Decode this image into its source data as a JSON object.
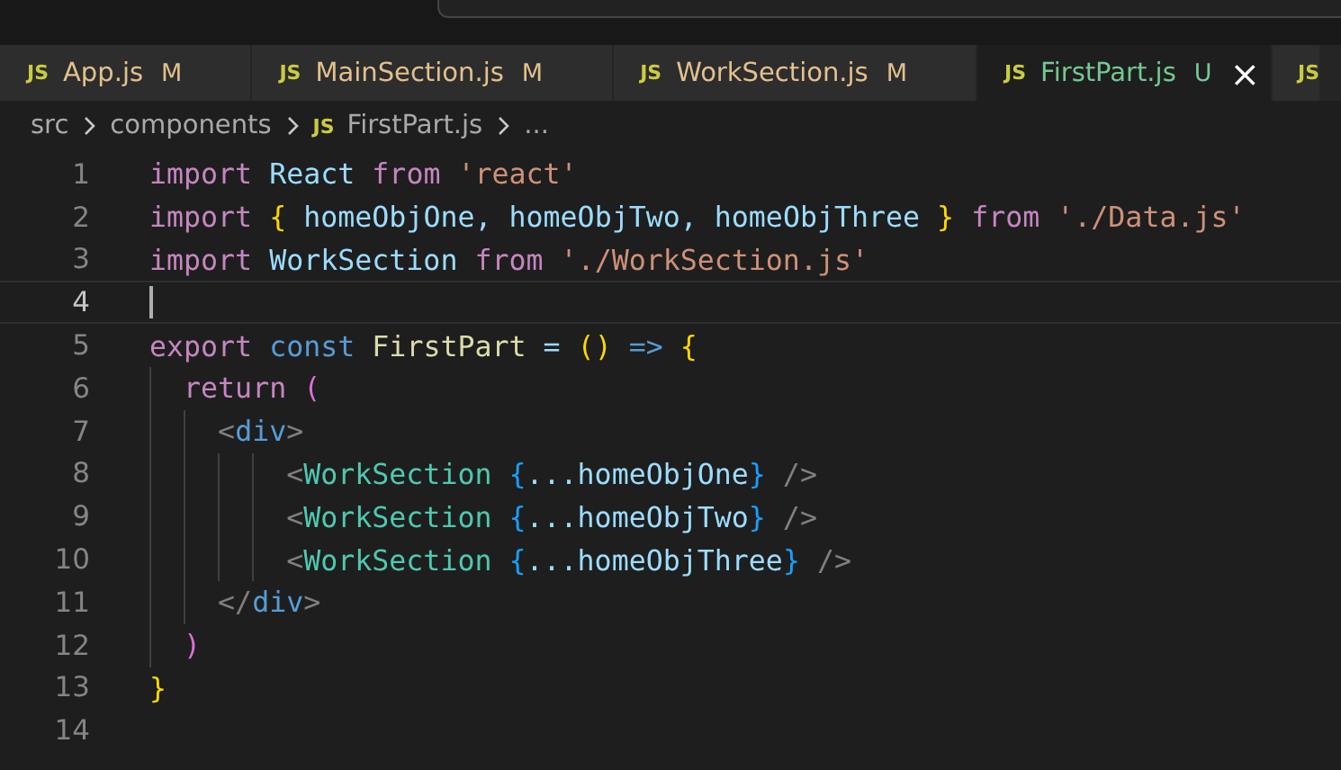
{
  "tabs": [
    {
      "icon": "JS",
      "label": "App.js",
      "status": "M",
      "kind": "modified",
      "selected": false
    },
    {
      "icon": "JS",
      "label": "MainSection.js",
      "status": "M",
      "kind": "modified",
      "selected": false
    },
    {
      "icon": "JS",
      "label": "WorkSection.js",
      "status": "M",
      "kind": "modified",
      "selected": false
    },
    {
      "icon": "JS",
      "label": "FirstPart.js",
      "status": "U",
      "kind": "untracked",
      "selected": true,
      "close": "×"
    },
    {
      "icon": "JS",
      "selected": false
    }
  ],
  "breadcrumb": [
    {
      "label": "src"
    },
    {
      "label": "components"
    },
    {
      "icon": "JS",
      "label": "FirstPart.js"
    },
    {
      "label": "..."
    }
  ],
  "editor": {
    "lines": [
      {
        "number": "1",
        "tokens": [
          {
            "kind": "kw",
            "text": "import"
          },
          {
            "kind": "var",
            "text": " React"
          },
          {
            "kind": "kw",
            "text": " from"
          },
          {
            "kind": "str",
            "text": " 'react'"
          }
        ]
      },
      {
        "number": "2",
        "tokens": [
          {
            "kind": "kw",
            "text": "import"
          },
          {
            "kind": "b1",
            "text": " {"
          },
          {
            "kind": "var",
            "text": " homeObjOne"
          },
          {
            "kind": "plain",
            "text": ","
          },
          {
            "kind": "var",
            "text": " homeObjTwo"
          },
          {
            "kind": "plain",
            "text": ","
          },
          {
            "kind": "var",
            "text": " homeObjThree"
          },
          {
            "kind": "b1",
            "text": " }"
          },
          {
            "kind": "kw",
            "text": " from"
          },
          {
            "kind": "str",
            "text": " './Data.js'"
          }
        ]
      },
      {
        "number": "3",
        "tokens": [
          {
            "kind": "kw",
            "text": "import"
          },
          {
            "kind": "var",
            "text": " WorkSection"
          },
          {
            "kind": "kw",
            "text": " from"
          },
          {
            "kind": "str",
            "text": " './WorkSection.js'"
          }
        ]
      },
      {
        "number": "4",
        "current": true
      },
      {
        "number": "5",
        "tokens": [
          {
            "kind": "kw",
            "text": "export"
          },
          {
            "kind": "storage",
            "text": " const"
          },
          {
            "kind": "fn",
            "text": " FirstPart"
          },
          {
            "kind": "plain",
            "text": " ="
          },
          {
            "kind": "b1",
            "text": " ()"
          },
          {
            "kind": "storage",
            "text": " =>"
          },
          {
            "kind": "b1",
            "text": " {"
          }
        ]
      },
      {
        "number": "6",
        "tokens": [
          {
            "kind": "kw",
            "text": "  return"
          },
          {
            "kind": "b2",
            "text": " ("
          }
        ]
      },
      {
        "number": "7",
        "tokens": [
          {
            "kind": "punct",
            "text": "    <"
          },
          {
            "kind": "tag",
            "text": "div"
          },
          {
            "kind": "punct",
            "text": ">"
          }
        ]
      },
      {
        "number": "8",
        "tokens": [
          {
            "kind": "punct",
            "text": "        <"
          },
          {
            "kind": "comp",
            "text": "WorkSection"
          },
          {
            "kind": "b3",
            "text": " {"
          },
          {
            "kind": "plain",
            "text": "...homeObjOne"
          },
          {
            "kind": "b3",
            "text": "}"
          },
          {
            "kind": "punct",
            "text": " />"
          }
        ]
      },
      {
        "number": "9",
        "tokens": [
          {
            "kind": "punct",
            "text": "        <"
          },
          {
            "kind": "comp",
            "text": "WorkSection"
          },
          {
            "kind": "b3",
            "text": " {"
          },
          {
            "kind": "plain",
            "text": "...homeObjTwo"
          },
          {
            "kind": "b3",
            "text": "}"
          },
          {
            "kind": "punct",
            "text": " />"
          }
        ]
      },
      {
        "number": "10",
        "tokens": [
          {
            "kind": "punct",
            "text": "        <"
          },
          {
            "kind": "comp",
            "text": "WorkSection"
          },
          {
            "kind": "b3",
            "text": " {"
          },
          {
            "kind": "plain",
            "text": "...homeObjThree"
          },
          {
            "kind": "b3",
            "text": "}"
          },
          {
            "kind": "punct",
            "text": " />"
          }
        ]
      },
      {
        "number": "11",
        "tokens": [
          {
            "kind": "punct",
            "text": "    </"
          },
          {
            "kind": "tag",
            "text": "div"
          },
          {
            "kind": "punct",
            "text": ">"
          }
        ]
      },
      {
        "number": "12",
        "tokens": [
          {
            "kind": "b2",
            "text": "  )"
          }
        ]
      },
      {
        "number": "13",
        "tokens": [
          {
            "kind": "b1",
            "text": "}"
          }
        ]
      },
      {
        "number": "14"
      }
    ]
  }
}
